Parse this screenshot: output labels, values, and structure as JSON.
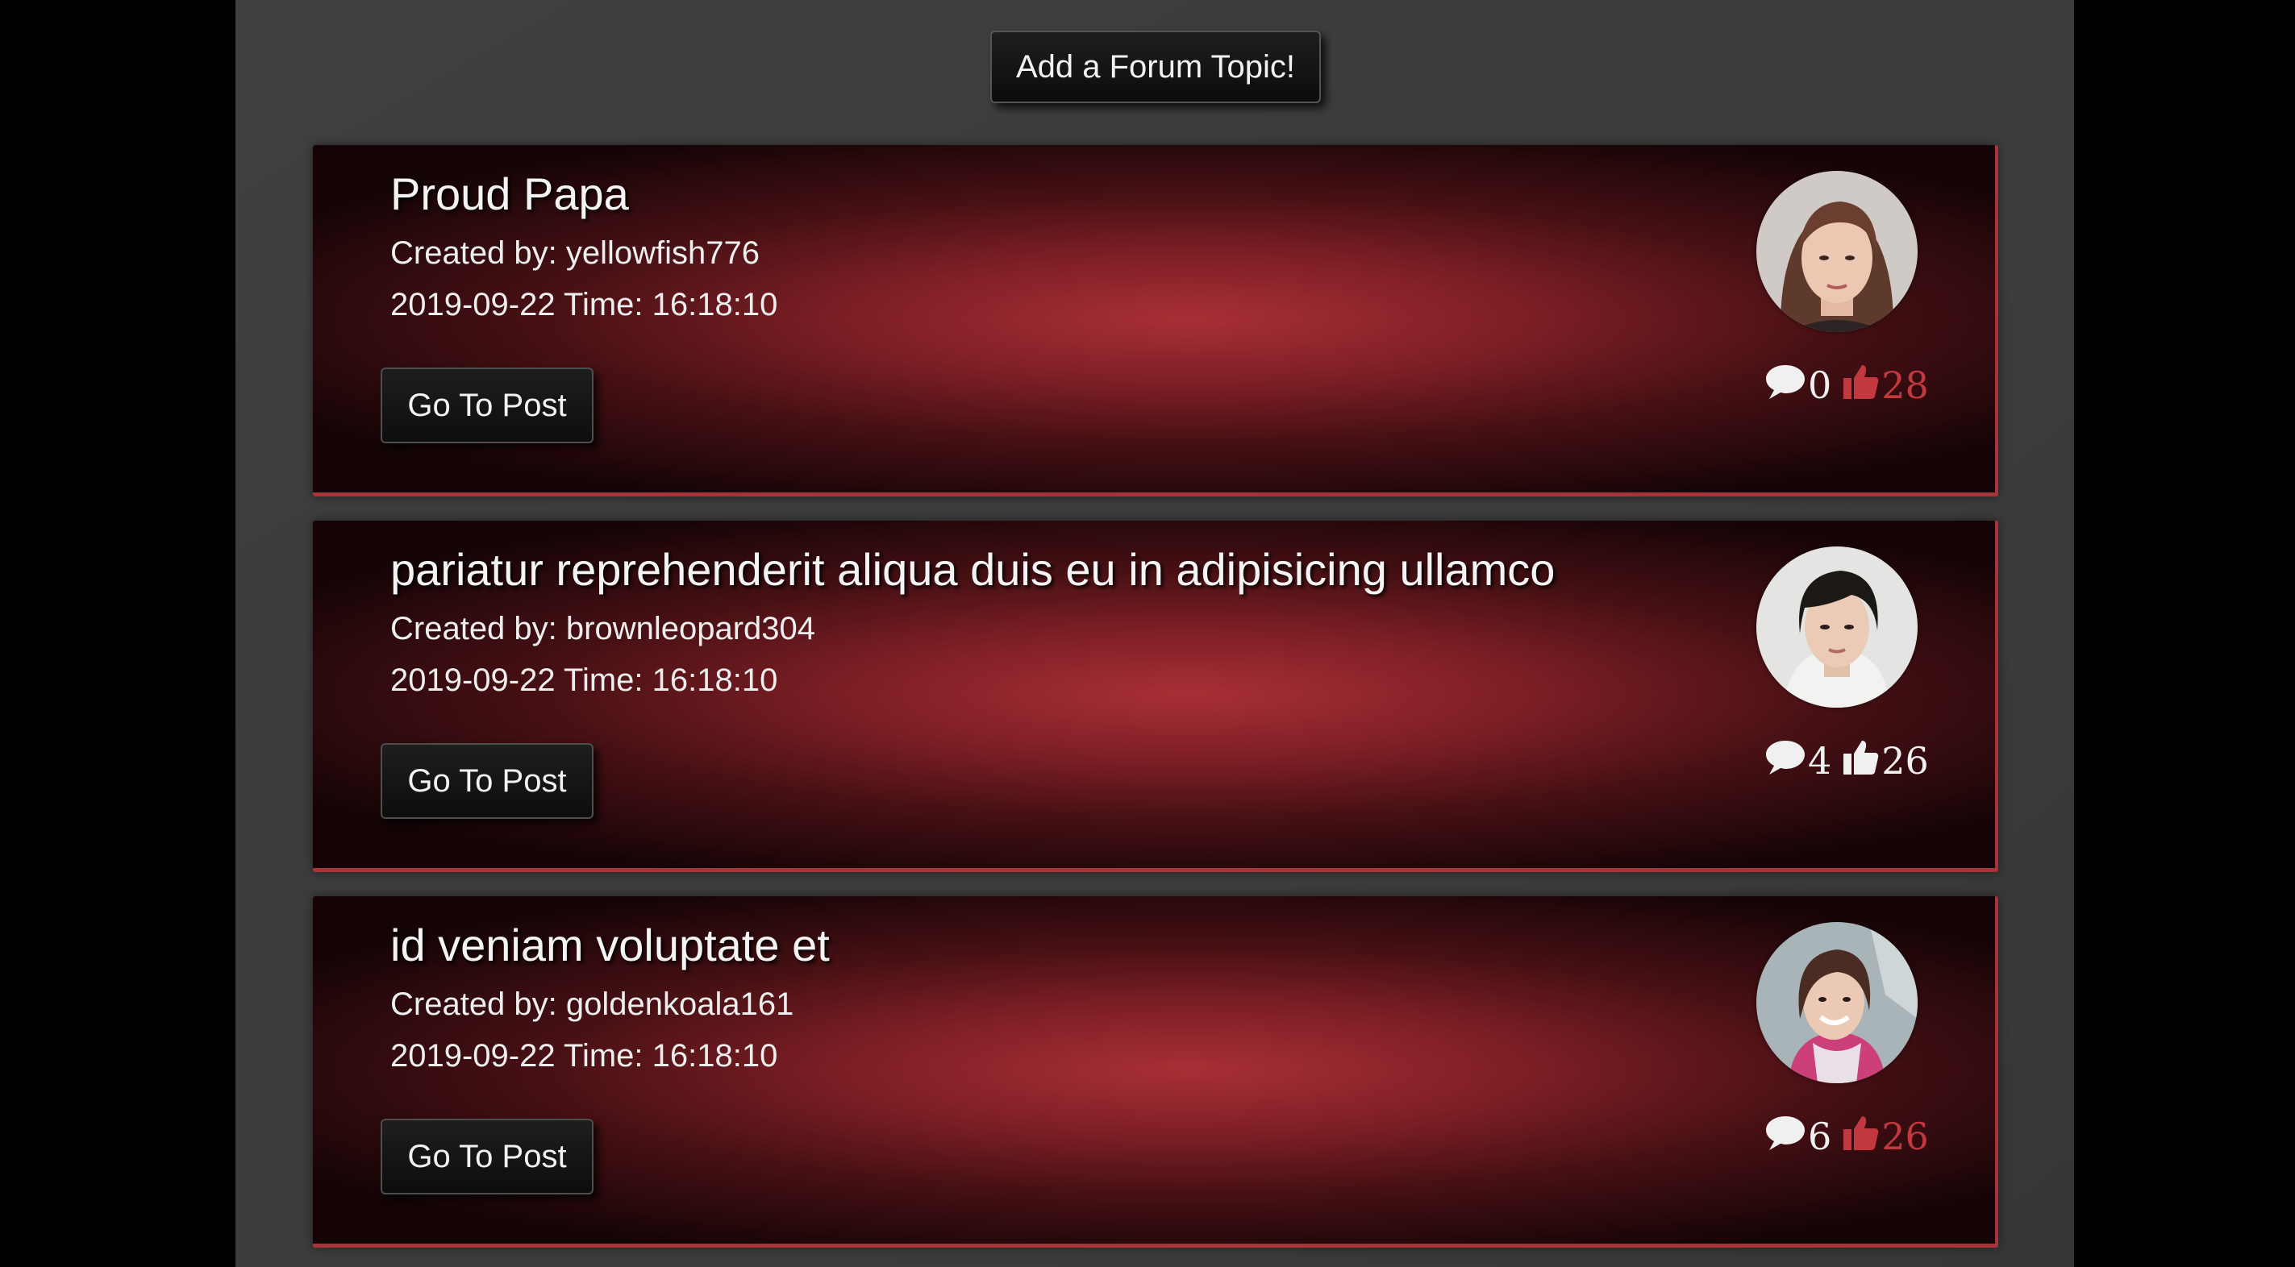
{
  "add_topic_label": "Add a Forum Topic!",
  "colors": {
    "accent_red": "#a83339",
    "liked_red": "#c2383f",
    "neutral_white": "#f0f0f0"
  },
  "posts": [
    {
      "title": "Proud Papa",
      "created_by": "Created by: yellowfish776",
      "datetime": "2019-09-22 Time: 16:18:10",
      "button_label": "Go To Post",
      "comments": "0",
      "likes": "28",
      "liked": true,
      "comment_icon": "speech-bubble-icon",
      "like_icon": "thumbs-up-icon"
    },
    {
      "title": "pariatur reprehenderit aliqua duis eu in adipisicing ullamco",
      "created_by": "Created by: brownleopard304",
      "datetime": "2019-09-22 Time: 16:18:10",
      "button_label": "Go To Post",
      "comments": "4",
      "likes": "26",
      "liked": false,
      "comment_icon": "speech-bubble-icon",
      "like_icon": "thumbs-up-icon"
    },
    {
      "title": "id veniam voluptate et",
      "created_by": "Created by: goldenkoala161",
      "datetime": "2019-09-22 Time: 16:18:10",
      "button_label": "Go To Post",
      "comments": "6",
      "likes": "26",
      "liked": true,
      "comment_icon": "speech-bubble-icon",
      "like_icon": "thumbs-up-icon"
    }
  ]
}
